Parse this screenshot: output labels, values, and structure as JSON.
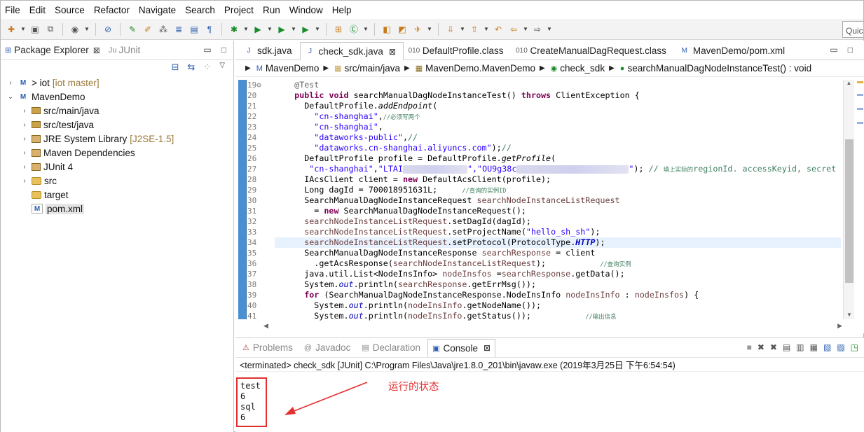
{
  "menu": [
    "File",
    "Edit",
    "Source",
    "Refactor",
    "Navigate",
    "Search",
    "Project",
    "Run",
    "Window",
    "Help"
  ],
  "toolbar": {
    "quick_access_placeholder": "Quic"
  },
  "explorer": {
    "tabs": {
      "package_explorer": "Package Explorer",
      "junit": "JUnit"
    },
    "tree": [
      {
        "label": "> iot",
        "deco": "[iot master]"
      },
      {
        "label": "MavenDemo"
      },
      {
        "label": "src/main/java"
      },
      {
        "label": "src/test/java"
      },
      {
        "label": "JRE System Library",
        "deco": "[J2SE-1.5]"
      },
      {
        "label": "Maven Dependencies"
      },
      {
        "label": "JUnit 4"
      },
      {
        "label": "src"
      },
      {
        "label": "target"
      },
      {
        "label": "pom.xml"
      }
    ]
  },
  "editor": {
    "tabs": [
      "sdk.java",
      "check_sdk.java",
      "DefaultProfile.class",
      "CreateManualDagRequest.class",
      "MavenDemo/pom.xml"
    ],
    "breadcrumb": [
      "MavenDemo",
      "src/main/java",
      "MavenDemo.MavenDemo",
      "check_sdk",
      "searchManualDagNodeInstanceTest() : void"
    ],
    "line_numbers": [
      "19⊖",
      "20",
      "21",
      "22",
      "23",
      "24",
      "25",
      "26",
      "27",
      "28",
      "29",
      "30",
      "31",
      "32",
      "33",
      "34",
      "35",
      "36",
      "37",
      "38",
      "39",
      "40",
      "41"
    ]
  },
  "bottom": {
    "tabs": [
      "Problems",
      "Javadoc",
      "Declaration",
      "Console"
    ],
    "status": "<terminated> check_sdk [JUnit] C:\\Program Files\\Java\\jre1.8.0_201\\bin\\javaw.exe (2019年3月25日 下午6:54:54)",
    "output": [
      "test",
      "6",
      "sql",
      "6"
    ]
  },
  "annotation": {
    "text": "运行的状态",
    "color": "#e53030"
  },
  "colors": {
    "keyword": "#7f0055",
    "string": "#2a00ff",
    "comment": "#3f7f5f",
    "ruler": "#4a8fd0",
    "highlight": "#e8f2fe"
  }
}
